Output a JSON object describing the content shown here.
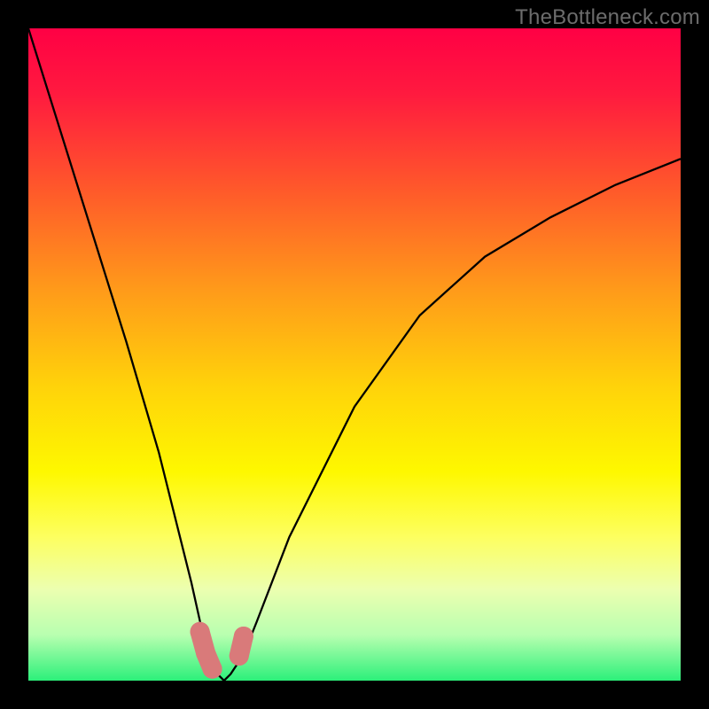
{
  "watermark": "TheBottleneck.com",
  "chart_data": {
    "type": "line",
    "title": "",
    "xlabel": "",
    "ylabel": "",
    "xlim": [
      0,
      100
    ],
    "ylim": [
      0,
      100
    ],
    "grid": false,
    "legend": false,
    "series": [
      {
        "name": "bottleneck-curve",
        "color": "#000000",
        "x": [
          0,
          5,
          10,
          15,
          20,
          25,
          27,
          29,
          30,
          31,
          33,
          35,
          40,
          50,
          60,
          70,
          80,
          90,
          100
        ],
        "values": [
          100,
          84,
          68,
          52,
          35,
          15,
          6,
          1,
          0,
          1,
          4,
          9,
          22,
          42,
          56,
          65,
          71,
          76,
          80
        ]
      }
    ],
    "markers": [
      {
        "name": "left-cluster",
        "color": "#d97a7a",
        "x": [
          26.3,
          27.2,
          28.2
        ],
        "y": [
          7.5,
          4.2,
          1.8
        ]
      },
      {
        "name": "right-cluster",
        "color": "#d97a7a",
        "x": [
          32.3,
          33.0
        ],
        "y": [
          3.8,
          6.8
        ]
      }
    ],
    "gradient_stops": [
      {
        "offset": 0.0,
        "color": "#ff0044"
      },
      {
        "offset": 0.1,
        "color": "#ff1a3f"
      },
      {
        "offset": 0.25,
        "color": "#ff5a2a"
      },
      {
        "offset": 0.4,
        "color": "#ff9a1a"
      },
      {
        "offset": 0.55,
        "color": "#ffd30a"
      },
      {
        "offset": 0.68,
        "color": "#fef800"
      },
      {
        "offset": 0.78,
        "color": "#fdff60"
      },
      {
        "offset": 0.86,
        "color": "#ecffb0"
      },
      {
        "offset": 0.93,
        "color": "#b8ffb0"
      },
      {
        "offset": 1.0,
        "color": "#2cf07a"
      }
    ],
    "annotations": []
  }
}
